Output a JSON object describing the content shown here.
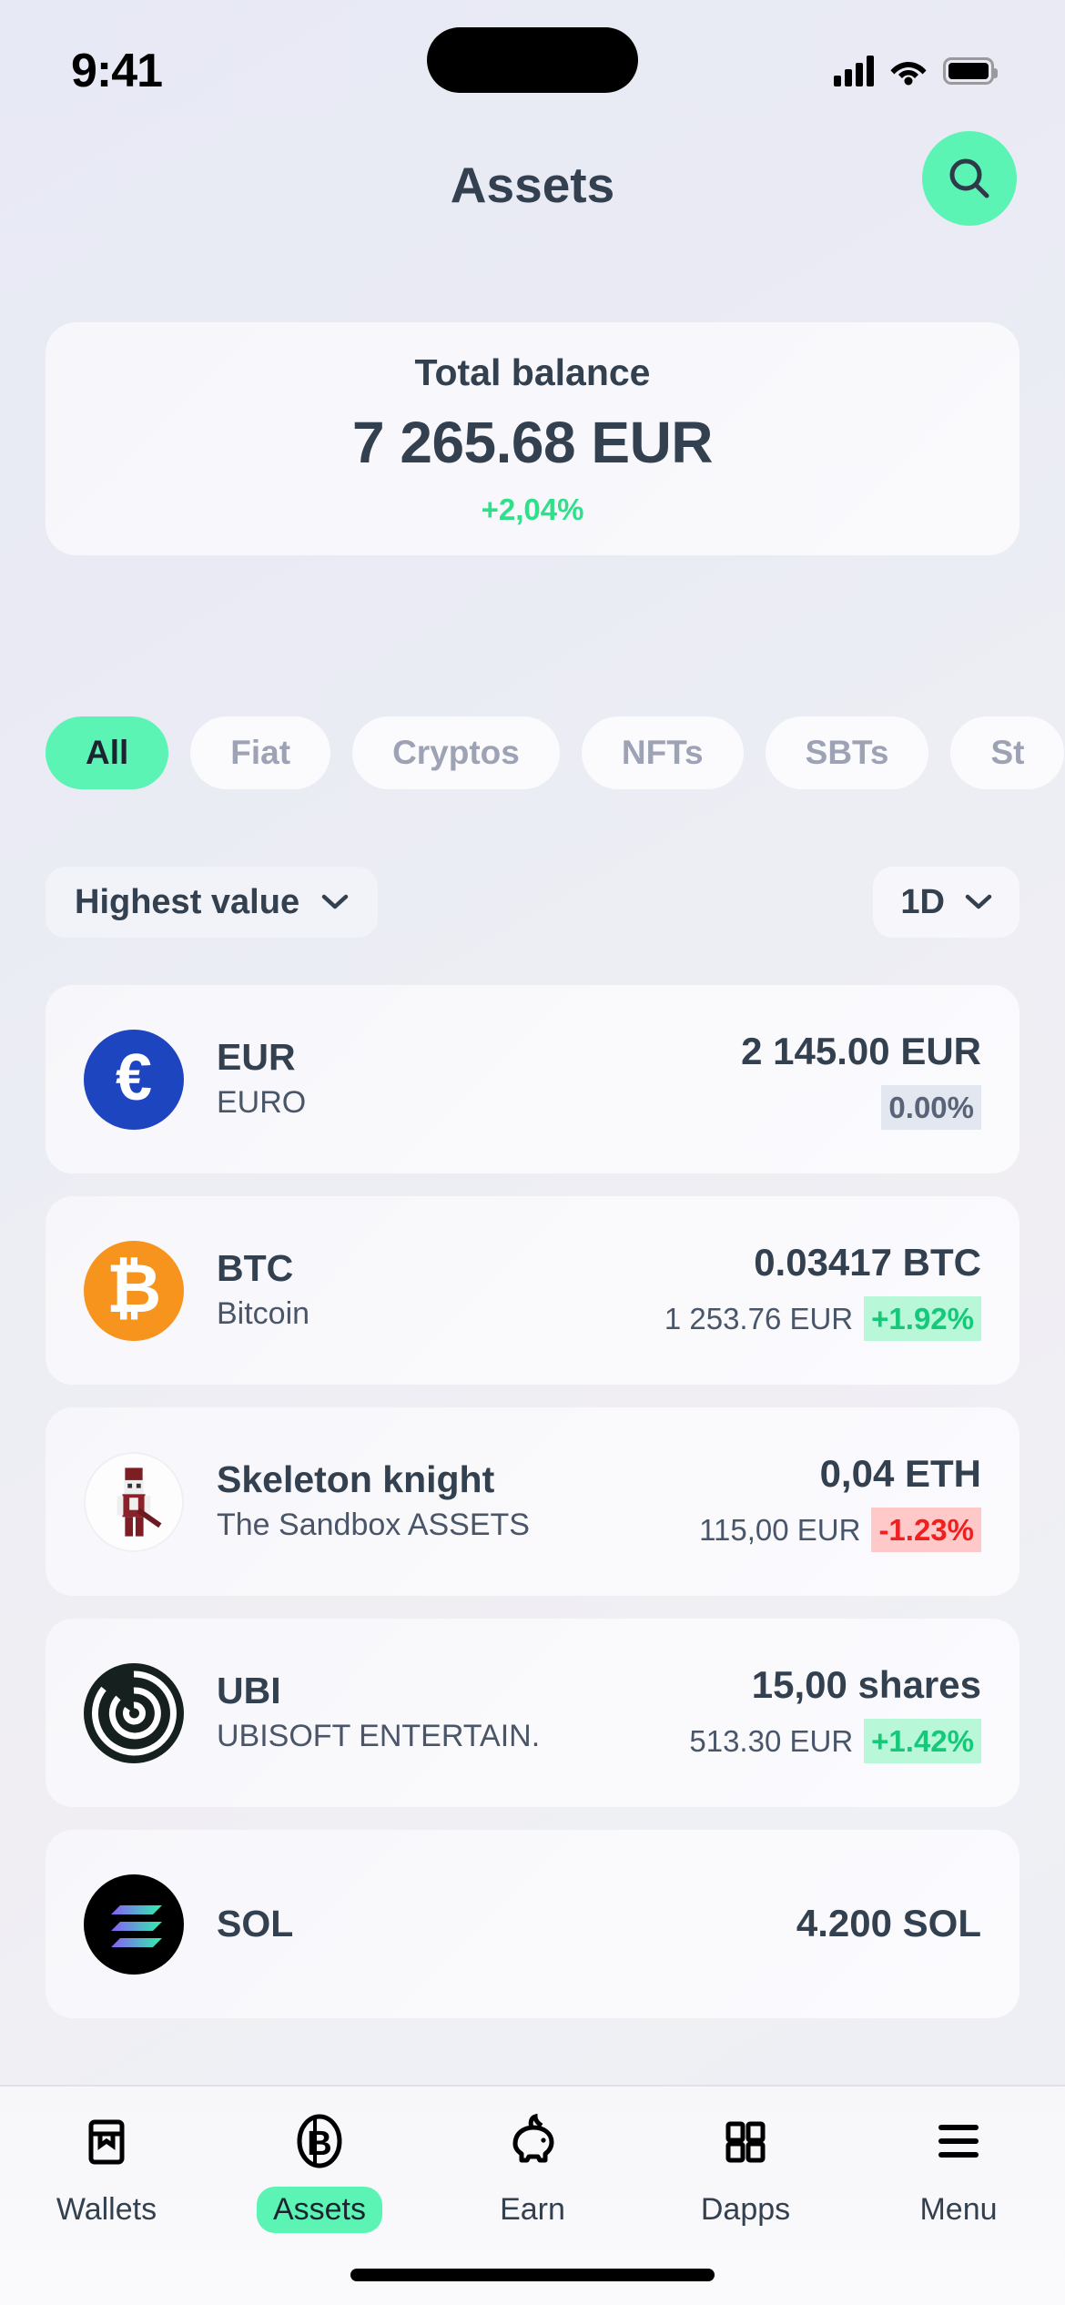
{
  "status_bar": {
    "time": "9:41",
    "signal_icon": "cellular-signal-icon",
    "wifi_icon": "wifi-icon",
    "battery_icon": "battery-icon"
  },
  "header": {
    "title": "Assets",
    "search_icon": "search-icon"
  },
  "balance": {
    "label": "Total balance",
    "amount": "7 265.68 EUR",
    "change": "+2,04%",
    "change_color": "#2fe08a"
  },
  "filters": {
    "chips": [
      {
        "label": "All",
        "active": true
      },
      {
        "label": "Fiat",
        "active": false
      },
      {
        "label": "Cryptos",
        "active": false
      },
      {
        "label": "NFTs",
        "active": false
      },
      {
        "label": "SBTs",
        "active": false
      },
      {
        "label": "St",
        "active": false
      }
    ]
  },
  "controls": {
    "sort_label": "Highest value",
    "range_label": "1D",
    "chevron_icon": "chevron-down-icon"
  },
  "assets": [
    {
      "symbol": "EUR",
      "name": "EURO",
      "quantity": "2 145.00 EUR",
      "fiat": "",
      "percent": "0.00%",
      "trend": "flat",
      "icon": "euro-coin-icon",
      "glyph": "€"
    },
    {
      "symbol": "BTC",
      "name": "Bitcoin",
      "quantity": "0.03417 BTC",
      "fiat": "1 253.76 EUR",
      "percent": "+1.92%",
      "trend": "up",
      "icon": "bitcoin-coin-icon",
      "glyph": "₿"
    },
    {
      "symbol": "Skeleton knight",
      "name": "The Sandbox ASSETS",
      "quantity": "0,04 ETH",
      "fiat": "115,00 EUR",
      "percent": "-1.23%",
      "trend": "down",
      "icon": "skeleton-knight-nft-icon",
      "glyph": ""
    },
    {
      "symbol": "UBI",
      "name": "UBISOFT ENTERTAIN.",
      "quantity": "15,00 shares",
      "fiat": "513.30 EUR",
      "percent": "+1.42%",
      "trend": "up",
      "icon": "ubisoft-logo-icon",
      "glyph": ""
    },
    {
      "symbol": "SOL",
      "name": "",
      "quantity": "4.200 SOL",
      "fiat": "",
      "percent": "",
      "trend": "flat",
      "icon": "solana-coin-icon",
      "glyph": ""
    }
  ],
  "tabbar": {
    "items": [
      {
        "label": "Wallets",
        "icon": "wallet-icon",
        "active": false
      },
      {
        "label": "Assets",
        "icon": "bitcoin-circle-icon",
        "active": true
      },
      {
        "label": "Earn",
        "icon": "piggy-bank-icon",
        "active": false
      },
      {
        "label": "Dapps",
        "icon": "grid-squares-icon",
        "active": false
      },
      {
        "label": "Menu",
        "icon": "hamburger-menu-icon",
        "active": false
      }
    ]
  },
  "theme": {
    "accent": "#5cf4b5",
    "text_dark": "#33404f",
    "up_color": "#14c97a",
    "down_color": "#f02020"
  }
}
